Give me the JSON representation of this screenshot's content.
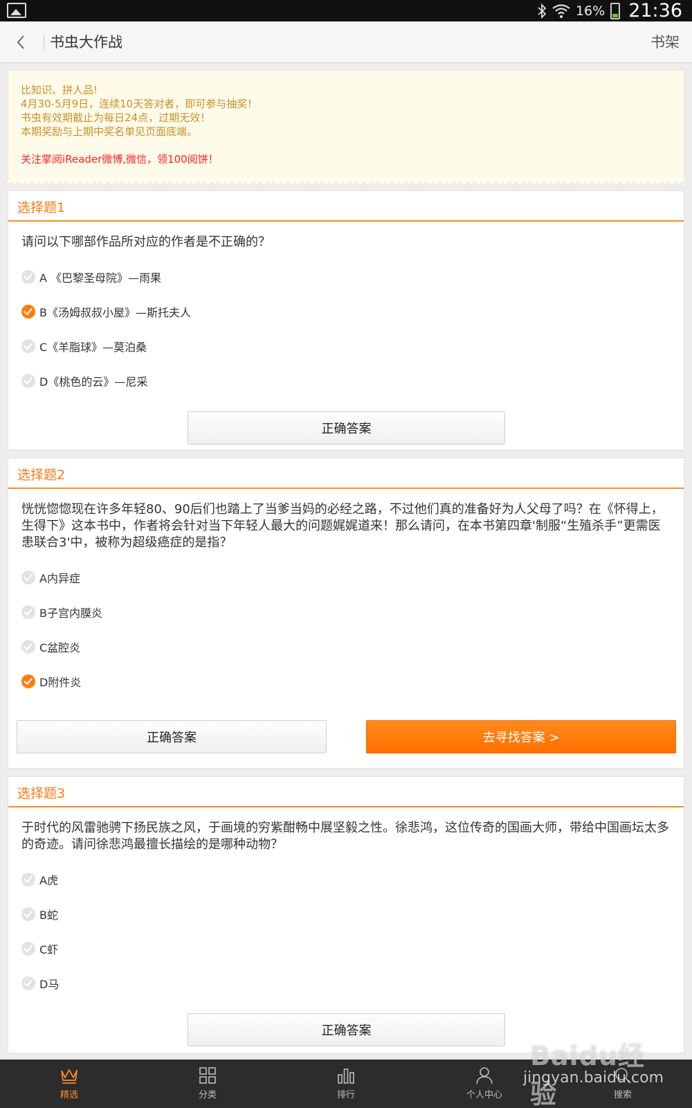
{
  "status_bar": {
    "battery": "16%",
    "time": "21:36"
  },
  "header": {
    "title": "书虫大作战",
    "right_action": "书架"
  },
  "notice": {
    "lines": [
      "比知识、拼人品!",
      "4月30-5月9日，连续10天答对者，即可参与抽奖！",
      "书虫有效期截止为每日24点，过期无效！",
      "本期奖励与上期中奖名单见页面底端。"
    ],
    "highlight": "关注掌阅iReader微博,微信，领100阅饼！"
  },
  "questions": [
    {
      "title": "选择题1",
      "text": "请问以下哪部作品所对应的作者是不正确的？",
      "options": [
        {
          "label": "A 《巴黎圣母院》—雨果",
          "selected": false
        },
        {
          "label": "B《汤姆叔叔小屋》—斯托夫人",
          "selected": true
        },
        {
          "label": "C《羊脂球》—莫泊桑",
          "selected": false
        },
        {
          "label": "D《桃色的云》—尼采",
          "selected": false
        }
      ],
      "answer_button": "正确答案"
    },
    {
      "title": "选择题2",
      "text": "恍恍惚惚现在许多年轻80、90后们也踏上了当爹当妈的必经之路，不过他们真的准备好为人父母了吗？在《怀得上，生得下》这本书中，作者将会针对当下年轻人最大的问题娓娓道来！那么请问，在本书第四章'制服“生殖杀手”更需医患联合3'中，被称为超级癌症的是指？",
      "options": [
        {
          "label": "A内异症",
          "selected": false
        },
        {
          "label": "B子宫内膜炎",
          "selected": false
        },
        {
          "label": "C盆腔炎",
          "selected": false
        },
        {
          "label": "D附件炎",
          "selected": true
        }
      ],
      "answer_button": "正确答案",
      "find_button": "去寻找答案 >"
    },
    {
      "title": "选择题3",
      "text": "于时代的风雷驰骋下扬民族之风，于画境的穷紫酣畅中展坚毅之性。徐悲鸿，这位传奇的国画大师，带给中国画坛太多的奇迹。请问徐悲鸿最擅长描绘的是哪种动物？",
      "options": [
        {
          "label": "A虎",
          "selected": false
        },
        {
          "label": "B蛇",
          "selected": false
        },
        {
          "label": "C虾",
          "selected": false
        },
        {
          "label": "D马",
          "selected": false
        }
      ],
      "answer_button": "正确答案"
    }
  ],
  "bottom_nav": [
    {
      "label": "精选",
      "icon": "crown-icon",
      "active": true
    },
    {
      "label": "分类",
      "icon": "grid-icon",
      "active": false
    },
    {
      "label": "排行",
      "icon": "bar-chart-icon",
      "active": false
    },
    {
      "label": "个人中心",
      "icon": "user-icon",
      "active": false
    },
    {
      "label": "搜索",
      "icon": "search-icon",
      "active": false
    }
  ],
  "watermark": {
    "logo": "Baidu经验",
    "url": "jingyan.baidu.com"
  },
  "colors": {
    "accent": "#ff7a16",
    "nav_bg": "#2c2c2c",
    "notice_bg": "#fffbea",
    "notice_text": "#c7902a",
    "highlight": "#ff2222"
  }
}
